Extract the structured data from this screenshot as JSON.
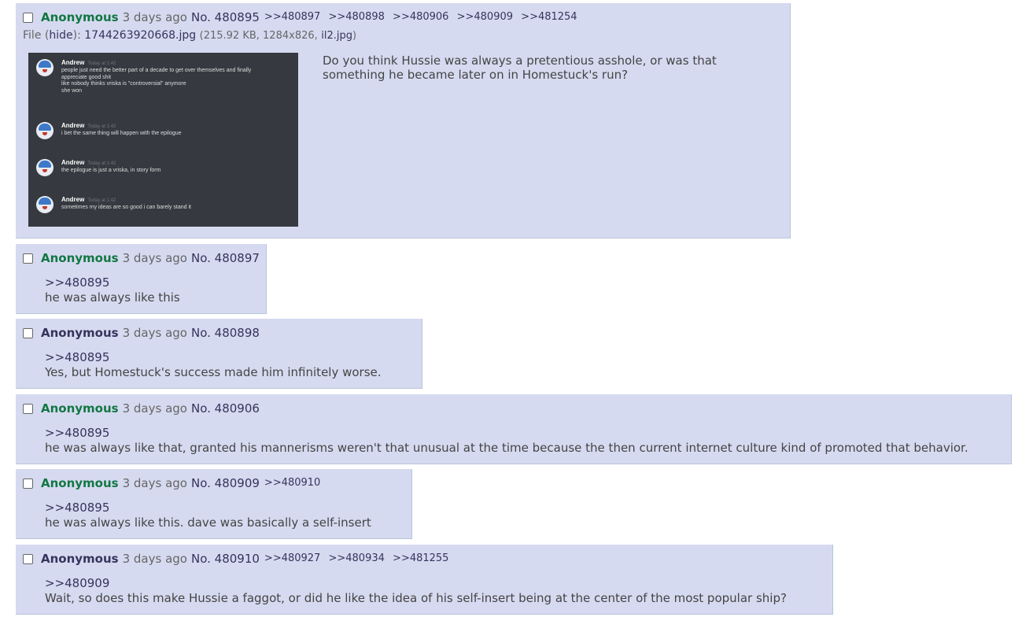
{
  "op": {
    "name": "Anonymous",
    "date": "3 days ago",
    "no": "No. 480895",
    "replies": [
      ">>480897",
      ">>480898",
      ">>480906",
      ">>480909",
      ">>481254"
    ],
    "file_label": "File",
    "file_hide": "(hide)",
    "file_sep": ":",
    "file_name": "1744263920668.jpg",
    "file_meta": "(215.92 KB, 1284x826,",
    "file_orig": "il2.jpg",
    "file_close": ")",
    "text_line1": "Do you think Hussie was always a pretentious asshole, or was that",
    "text_line2": "something he became later on in Homestuck's run?"
  },
  "thumbnail": {
    "messages": [
      {
        "author": "Andrew",
        "stamp": "Today at 1:42",
        "lines": [
          "people just need the better part of a decade to get over themselves and finally",
          "appreciate good shit",
          "like nobody thinks vriska is \"controversial\" anymore",
          "she won"
        ]
      },
      {
        "author": "Andrew",
        "stamp": "Today at 1:42",
        "lines": [
          "i bet the same thing will happen with the epilogue"
        ]
      },
      {
        "author": "Andrew",
        "stamp": "Today at 1:42",
        "lines": [
          "the epilogue is just a vriska, in story form"
        ]
      },
      {
        "author": "Andrew",
        "stamp": "Today at 1:42",
        "lines": [
          "sometimes my ideas are so good i can barely stand it"
        ]
      }
    ]
  },
  "posts": [
    {
      "name": "Anonymous",
      "date": "3 days ago",
      "no": "No. 480897",
      "replies": [],
      "quote": ">>480895",
      "text": "he was always like this"
    },
    {
      "name": "Anonymous",
      "date": "3 days ago",
      "no": "No. 480898",
      "replies": [],
      "quote": ">>480895",
      "text": "Yes, but Homestuck's success made him infinitely worse."
    },
    {
      "name": "Anonymous",
      "date": "3 days ago",
      "no": "No. 480906",
      "replies": [],
      "quote": ">>480895",
      "text": "he was always like that, granted his mannerisms weren't that unusual at the time because the then current internet culture kind of promoted that behavior."
    },
    {
      "name": "Anonymous",
      "date": "3 days ago",
      "no": "No. 480909",
      "replies": [
        ">>480910"
      ],
      "quote": ">>480895",
      "text": "he was always like this. dave was basically a self-insert"
    },
    {
      "name": "Anonymous",
      "date": "3 days ago",
      "no": "No. 480910",
      "replies": [
        ">>480927",
        ">>480934",
        ">>481255"
      ],
      "quote": ">>480909",
      "text": "Wait, so does this make Hussie a faggot, or did he like the idea of his self-insert being at the center of the most popular ship?"
    }
  ]
}
